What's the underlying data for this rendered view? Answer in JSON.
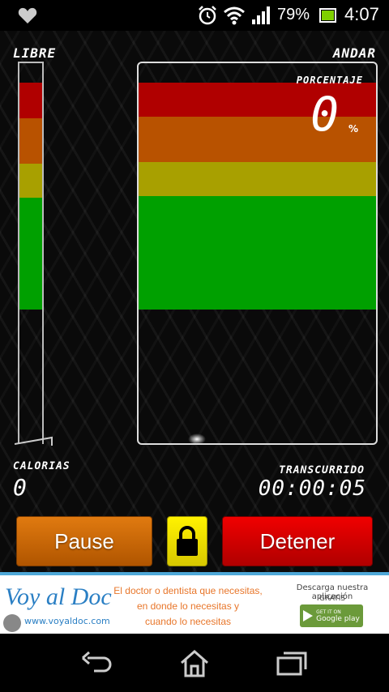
{
  "status_bar": {
    "battery_percent": "79%",
    "time": "4:07",
    "icons": [
      "heart-icon",
      "alarm-icon",
      "wifi-icon",
      "signal-icon",
      "battery-icon"
    ]
  },
  "labels": {
    "libre": "LIBRE",
    "andar": "ANDAR",
    "porcentaje": "PORCENTAJE",
    "percent_unit": "%",
    "calorias": "CALORIAS",
    "transcurrido": "TRANSCURRIDO"
  },
  "values": {
    "percentage": "0",
    "calorias": "0",
    "transcurrido": "00:00:05"
  },
  "zone_colors": {
    "red": "#b00000",
    "orange": "#b85200",
    "yellow": "#a8a000",
    "green": "#00a000"
  },
  "buttons": {
    "pause": "Pause",
    "lock_icon": "lock-icon",
    "detener": "Detener"
  },
  "ad": {
    "logo_text": "Voy al Doc",
    "url": "www.voyaldoc.com",
    "tagline_line1": "El doctor o dentista que necesitas,",
    "tagline_line2": "en donde lo necesitas y",
    "tagline_line3": "cuando lo necesitas",
    "download_text": "Descarga nuestra aplicación",
    "gratis": "GRATIS",
    "store_small": "GET IT ON",
    "store_name": "Google play"
  },
  "nav": {
    "icons": [
      "back-icon",
      "home-icon",
      "recent-apps-icon"
    ]
  }
}
